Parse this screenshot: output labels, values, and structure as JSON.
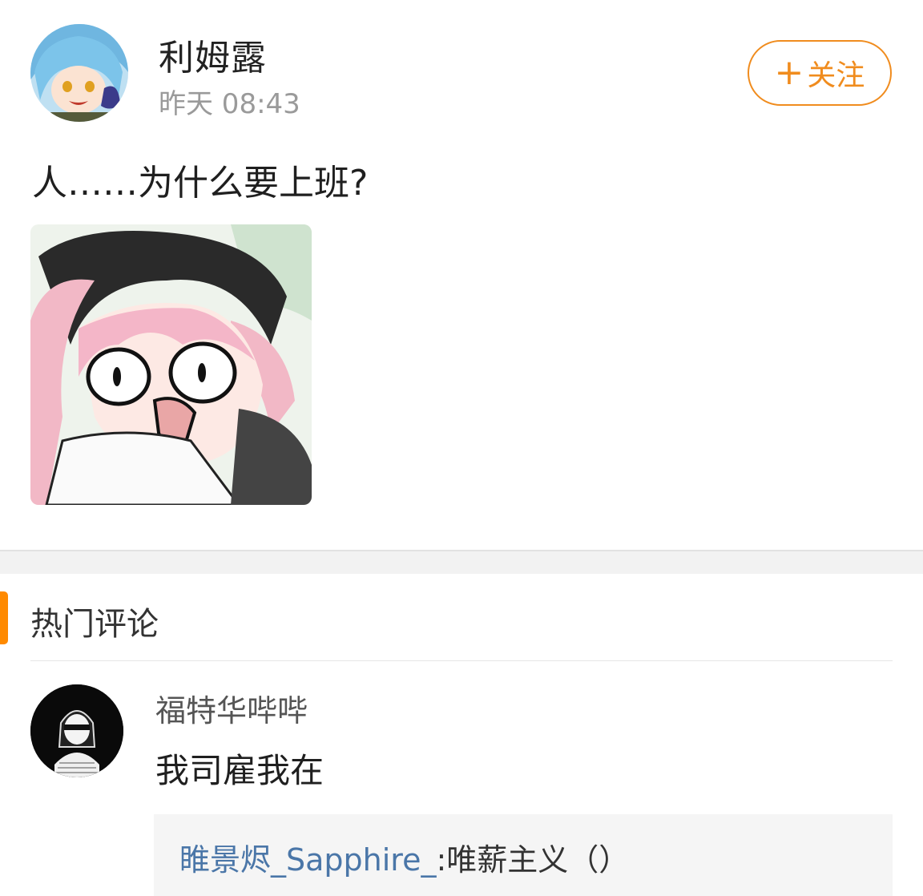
{
  "post": {
    "author": "利姆露",
    "time": "昨天 08:43",
    "follow_label": "关注",
    "follow_icon": "plus-icon",
    "text": "人……为什么要上班?",
    "colors": {
      "accent": "#f08c1e"
    }
  },
  "comments": {
    "section_title": "热门评论",
    "accent_color": "#ff8a00",
    "items": [
      {
        "user": "福特华哔哔",
        "text": "我司雇我在",
        "reply": {
          "user": "睢景烬_Sapphire_",
          "text": ":唯薪主义（）"
        }
      }
    ]
  }
}
